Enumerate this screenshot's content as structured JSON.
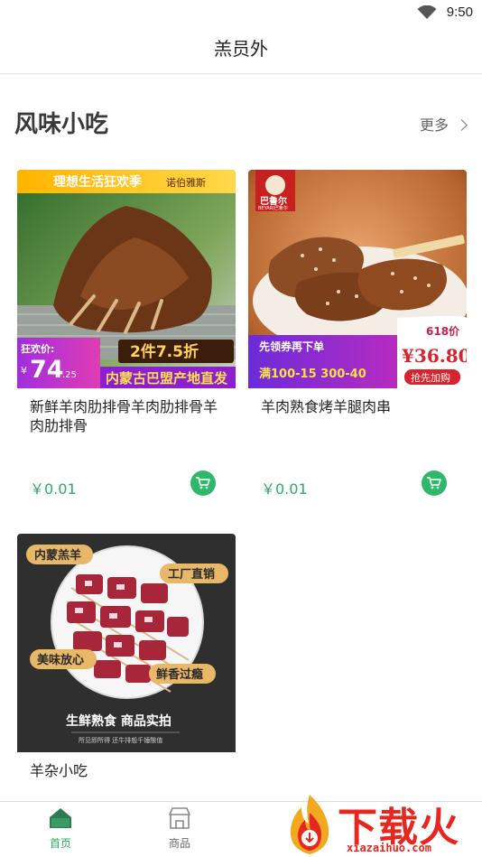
{
  "status_bar": {
    "time": "9:50"
  },
  "header": {
    "title": "羔员外"
  },
  "section": {
    "title": "风味小吃",
    "more_label": "更多"
  },
  "products": [
    {
      "name": "新鲜羊肉肋排骨羊肉肋排骨羊肉肋排骨",
      "price": "￥0.01",
      "image_texts": {
        "banner": "理想生活狂欢季",
        "brand": "诺伯雅斯",
        "price_label": "狂欢价:",
        "price_currency": "¥",
        "price_big": "74",
        "price_small": ".25",
        "promo": "2件7.5折",
        "footer": "内蒙古巴盟产地直发"
      }
    },
    {
      "name": "羊肉熟食烤羊腿肉串",
      "price": "￥0.01",
      "image_texts": {
        "brand": "巴鲁尔",
        "brand_en": "BEYAR|巴鲁尔",
        "coupon": "先领券再下单",
        "event": "618价",
        "price": "¥36.80",
        "discount": "满100-15  300-40",
        "buy": "抢先加购"
      }
    },
    {
      "name": "羊杂小吃",
      "image_texts": {
        "tag1": "内蒙羔羊",
        "tag2": "工厂直销",
        "tag3": "美味放心",
        "tag4": "鲜香过瘾",
        "slogan": "生鲜熟食  商品实拍",
        "sub": "所见即所得  还牛排般千锤酸值"
      }
    }
  ],
  "tabbar": {
    "tabs": [
      {
        "label": "首页",
        "icon": "home-icon",
        "active": true
      },
      {
        "label": "商品",
        "icon": "store-icon",
        "active": false
      }
    ]
  },
  "watermark": {
    "text": "下载火",
    "url": "xiazaihuo.com"
  },
  "colors": {
    "accent": "#2faa62",
    "tab_active": "#2faa62",
    "watermark": "#e6261f"
  }
}
